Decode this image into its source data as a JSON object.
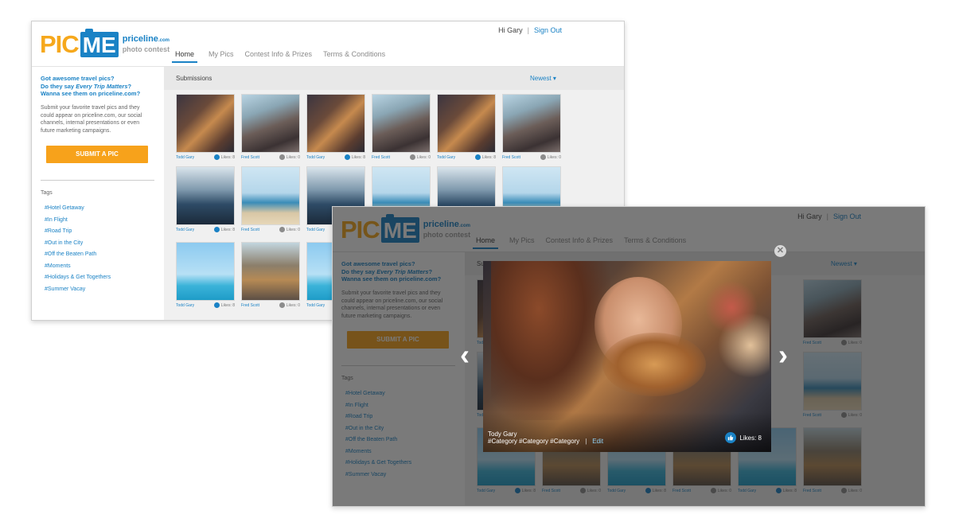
{
  "logo": {
    "pic": "PIC",
    "me": "ME",
    "brand": "priceline",
    "brand_suffix": ".com",
    "sub": "photo contest"
  },
  "user": {
    "greeting": "Hi Gary",
    "separator": "|",
    "signout": "Sign Out"
  },
  "nav": {
    "tabs": [
      {
        "label": "Home"
      },
      {
        "label": "My Pics"
      },
      {
        "label": "Contest Info & Prizes"
      },
      {
        "label": "Terms & Conditions"
      }
    ]
  },
  "sidebar": {
    "promo_line1": "Got awesome travel pics?",
    "promo_line2_pre": "Do they say ",
    "promo_line2_em": "Every Trip Matters",
    "promo_line2_post": "?",
    "promo_line3": "Wanna see them on priceline.com?",
    "description": "Submit your favorite travel pics and they could appear on priceline.com, our social channels, internal presentations or even future marketing campaigns.",
    "submit_label": "SUBMIT A PIC",
    "tags_heading": "Tags",
    "tags": [
      "#Hotel Getaway",
      "#In Flight",
      "#Road Trip",
      "#Out in the City",
      "#Off the Beaten Path",
      "#Moments",
      "#Holidays & Get Togethers",
      "#Summer Vacay"
    ]
  },
  "main": {
    "heading": "Submissions",
    "sort_label": "Newest ▾"
  },
  "cards": [
    {
      "name": "Todd Gary",
      "likes": "Likes: 8",
      "liked": true
    },
    {
      "name": "Fred Scott",
      "likes": "Likes: 0",
      "liked": false
    },
    {
      "name": "Todd Gary",
      "likes": "Likes: 8",
      "liked": true
    },
    {
      "name": "Fred Scott",
      "likes": "Likes: 0",
      "liked": false
    },
    {
      "name": "Todd Gary",
      "likes": "Likes: 8",
      "liked": true
    },
    {
      "name": "Fred Scott",
      "likes": "Likes: 0",
      "liked": false
    }
  ],
  "modal": {
    "author": "Tody Gary",
    "categories": "#Category #Category #Category",
    "separator": "|",
    "edit": "Edit",
    "likes": "Likes: 8",
    "close_glyph": "✕",
    "prev_glyph": "‹",
    "next_glyph": "›"
  },
  "colors": {
    "brand_blue": "#1a82c5",
    "brand_orange": "#f7a21b"
  }
}
